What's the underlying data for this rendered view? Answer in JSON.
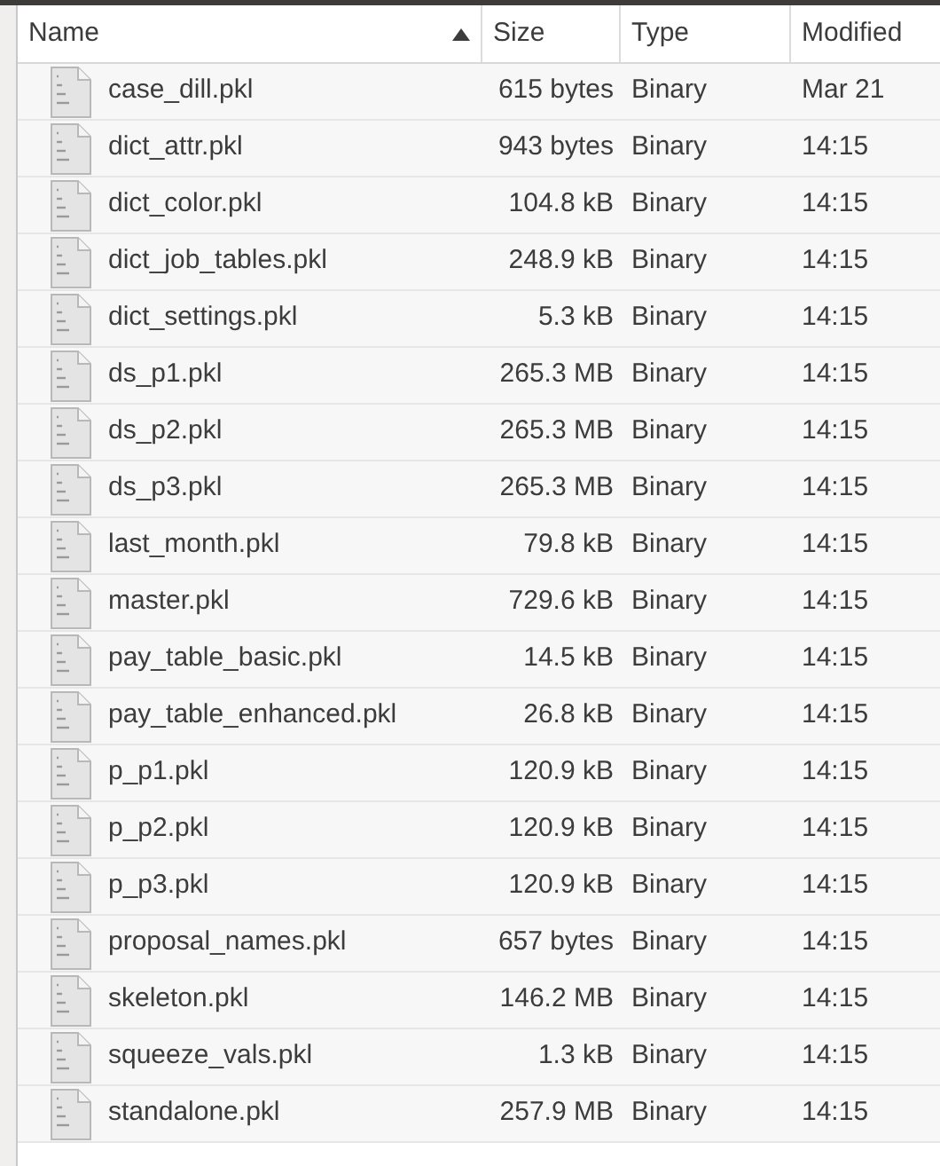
{
  "table": {
    "columns": [
      {
        "label": "Name",
        "sorted": true
      },
      {
        "label": "Size",
        "sorted": false
      },
      {
        "label": "Type",
        "sorted": false
      },
      {
        "label": "Modified",
        "sorted": false
      }
    ],
    "rows": [
      {
        "name": "case_dill.pkl",
        "size": "615 bytes",
        "type": "Binary",
        "modified": "Mar 21"
      },
      {
        "name": "dict_attr.pkl",
        "size": "943 bytes",
        "type": "Binary",
        "modified": "14:15"
      },
      {
        "name": "dict_color.pkl",
        "size": "104.8 kB",
        "type": "Binary",
        "modified": "14:15"
      },
      {
        "name": "dict_job_tables.pkl",
        "size": "248.9 kB",
        "type": "Binary",
        "modified": "14:15"
      },
      {
        "name": "dict_settings.pkl",
        "size": "5.3 kB",
        "type": "Binary",
        "modified": "14:15"
      },
      {
        "name": "ds_p1.pkl",
        "size": "265.3 MB",
        "type": "Binary",
        "modified": "14:15"
      },
      {
        "name": "ds_p2.pkl",
        "size": "265.3 MB",
        "type": "Binary",
        "modified": "14:15"
      },
      {
        "name": "ds_p3.pkl",
        "size": "265.3 MB",
        "type": "Binary",
        "modified": "14:15"
      },
      {
        "name": "last_month.pkl",
        "size": "79.8 kB",
        "type": "Binary",
        "modified": "14:15"
      },
      {
        "name": "master.pkl",
        "size": "729.6 kB",
        "type": "Binary",
        "modified": "14:15"
      },
      {
        "name": "pay_table_basic.pkl",
        "size": "14.5 kB",
        "type": "Binary",
        "modified": "14:15"
      },
      {
        "name": "pay_table_enhanced.pkl",
        "size": "26.8 kB",
        "type": "Binary",
        "modified": "14:15"
      },
      {
        "name": "p_p1.pkl",
        "size": "120.9 kB",
        "type": "Binary",
        "modified": "14:15"
      },
      {
        "name": "p_p2.pkl",
        "size": "120.9 kB",
        "type": "Binary",
        "modified": "14:15"
      },
      {
        "name": "p_p3.pkl",
        "size": "120.9 kB",
        "type": "Binary",
        "modified": "14:15"
      },
      {
        "name": "proposal_names.pkl",
        "size": "657 bytes",
        "type": "Binary",
        "modified": "14:15"
      },
      {
        "name": "skeleton.pkl",
        "size": "146.2 MB",
        "type": "Binary",
        "modified": "14:15"
      },
      {
        "name": "squeeze_vals.pkl",
        "size": "1.3 kB",
        "type": "Binary",
        "modified": "14:15"
      },
      {
        "name": "standalone.pkl",
        "size": "257.9 MB",
        "type": "Binary",
        "modified": "14:15"
      }
    ]
  }
}
